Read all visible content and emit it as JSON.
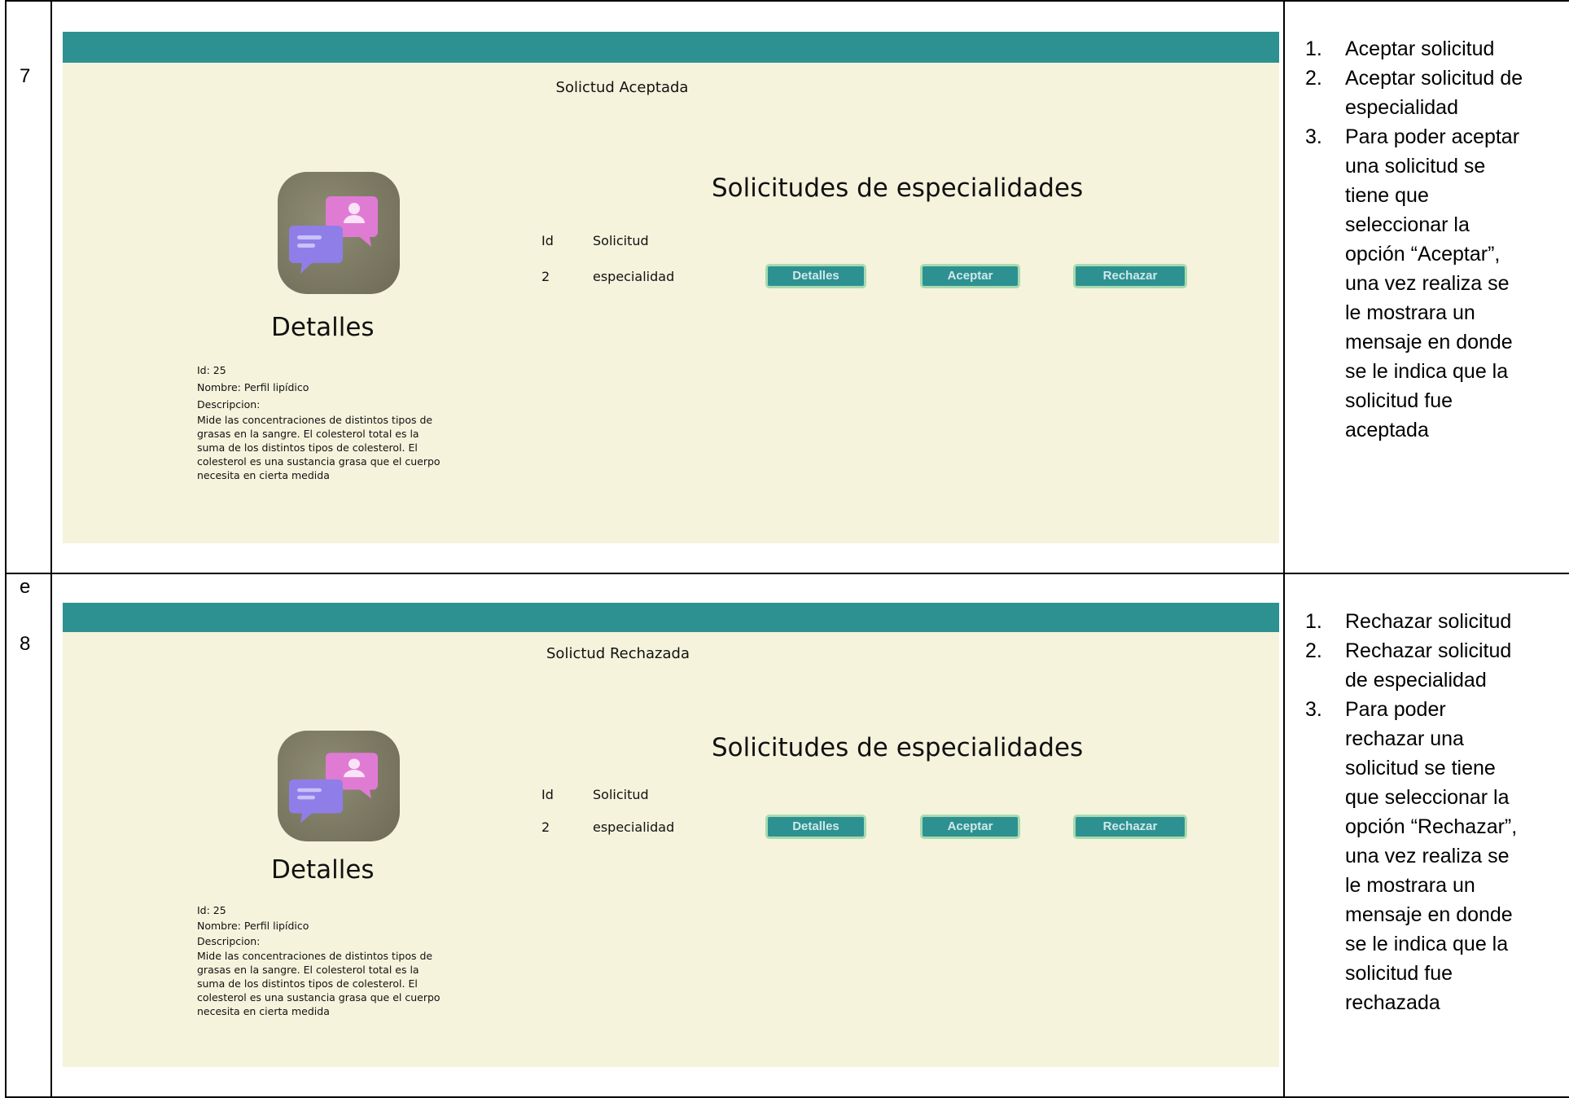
{
  "rows": [
    {
      "number_label": "7",
      "screenshot": {
        "notice": "Solictud Aceptada",
        "details": {
          "title": "Detalles",
          "id_line": "Id: 25",
          "name_line": "Nombre: Perfil lipídico",
          "description_label": "Descripcion:",
          "description": "Mide las concentraciones de distintos tipos de grasas en la sangre. El colesterol total es la suma de los distintos tipos de colesterol. El colesterol es una sustancia grasa que el cuerpo necesita en cierta medida"
        },
        "list": {
          "title": "Solicitudes de especialidades",
          "headers": [
            "Id",
            "Solicitud"
          ],
          "row": {
            "id": "2",
            "solicitud": "especialidad"
          },
          "buttons": [
            "Detalles",
            "Aceptar",
            "Rechazar"
          ]
        }
      },
      "steps": [
        "Aceptar solicitud",
        "Aceptar solicitud de especialidad",
        "Para poder aceptar una solicitud se tiene que seleccionar la opción “Aceptar”, una vez realiza se le mostrara un mensaje en donde se le indica que la solicitud fue aceptada"
      ]
    },
    {
      "number_prefix": "e",
      "number_label": "8",
      "screenshot": {
        "notice": "Solictud Rechazada",
        "details": {
          "title": "Detalles",
          "id_line": "Id: 25",
          "name_line": "Nombre: Perfil lipídico",
          "description_label": "Descripcion:",
          "description": "Mide las concentraciones de distintos tipos de grasas en la sangre. El colesterol total es la suma de los distintos tipos de colesterol. El colesterol es una sustancia grasa que el cuerpo necesita en cierta medida"
        },
        "list": {
          "title": "Solicitudes de especialidades",
          "headers": [
            "Id",
            "Solicitud"
          ],
          "row": {
            "id": "2",
            "solicitud": "especialidad"
          },
          "buttons": [
            "Detalles",
            "Aceptar",
            "Rechazar"
          ]
        }
      },
      "steps": [
        "Rechazar solicitud",
        "Rechazar solicitud de especialidad",
        "Para poder rechazar una solicitud se tiene que seleccionar la opción “Rechazar”, una vez realiza se le mostrara un mensaje en donde se le indica que la solicitud fue rechazada"
      ]
    }
  ],
  "colors": {
    "header_bar": "#2e9191",
    "panel_background": "#f5f3dc",
    "button_border": "#a7dbb0"
  },
  "icons": [
    "chat-bubbles-icon"
  ]
}
